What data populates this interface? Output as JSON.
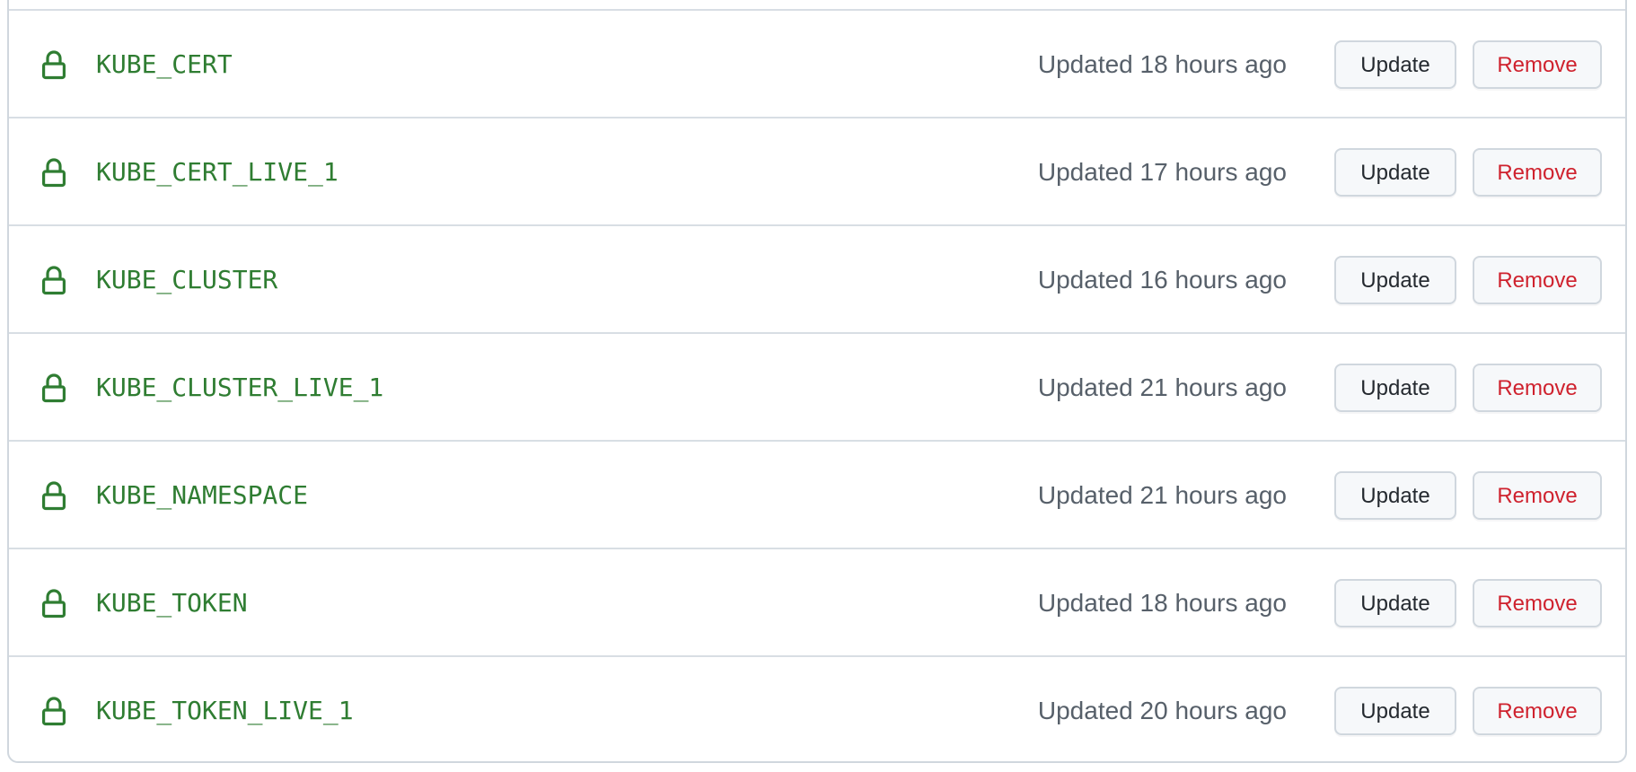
{
  "secrets": [
    {
      "name": "KUBE_CERT",
      "updated": "Updated 18 hours ago",
      "update_label": "Update",
      "remove_label": "Remove"
    },
    {
      "name": "KUBE_CERT_LIVE_1",
      "updated": "Updated 17 hours ago",
      "update_label": "Update",
      "remove_label": "Remove"
    },
    {
      "name": "KUBE_CLUSTER",
      "updated": "Updated 16 hours ago",
      "update_label": "Update",
      "remove_label": "Remove"
    },
    {
      "name": "KUBE_CLUSTER_LIVE_1",
      "updated": "Updated 21 hours ago",
      "update_label": "Update",
      "remove_label": "Remove"
    },
    {
      "name": "KUBE_NAMESPACE",
      "updated": "Updated 21 hours ago",
      "update_label": "Update",
      "remove_label": "Remove"
    },
    {
      "name": "KUBE_TOKEN",
      "updated": "Updated 18 hours ago",
      "update_label": "Update",
      "remove_label": "Remove"
    },
    {
      "name": "KUBE_TOKEN_LIVE_1",
      "updated": "Updated 20 hours ago",
      "update_label": "Update",
      "remove_label": "Remove"
    }
  ],
  "icons": {
    "secret": "lock-icon"
  },
  "colors": {
    "secret_name": "#2f7d32",
    "lock_icon": "#2f7d32",
    "updated_text": "#57606a",
    "remove_text": "#cf222e",
    "button_bg": "#f6f8fa",
    "border": "#d0d7de"
  }
}
